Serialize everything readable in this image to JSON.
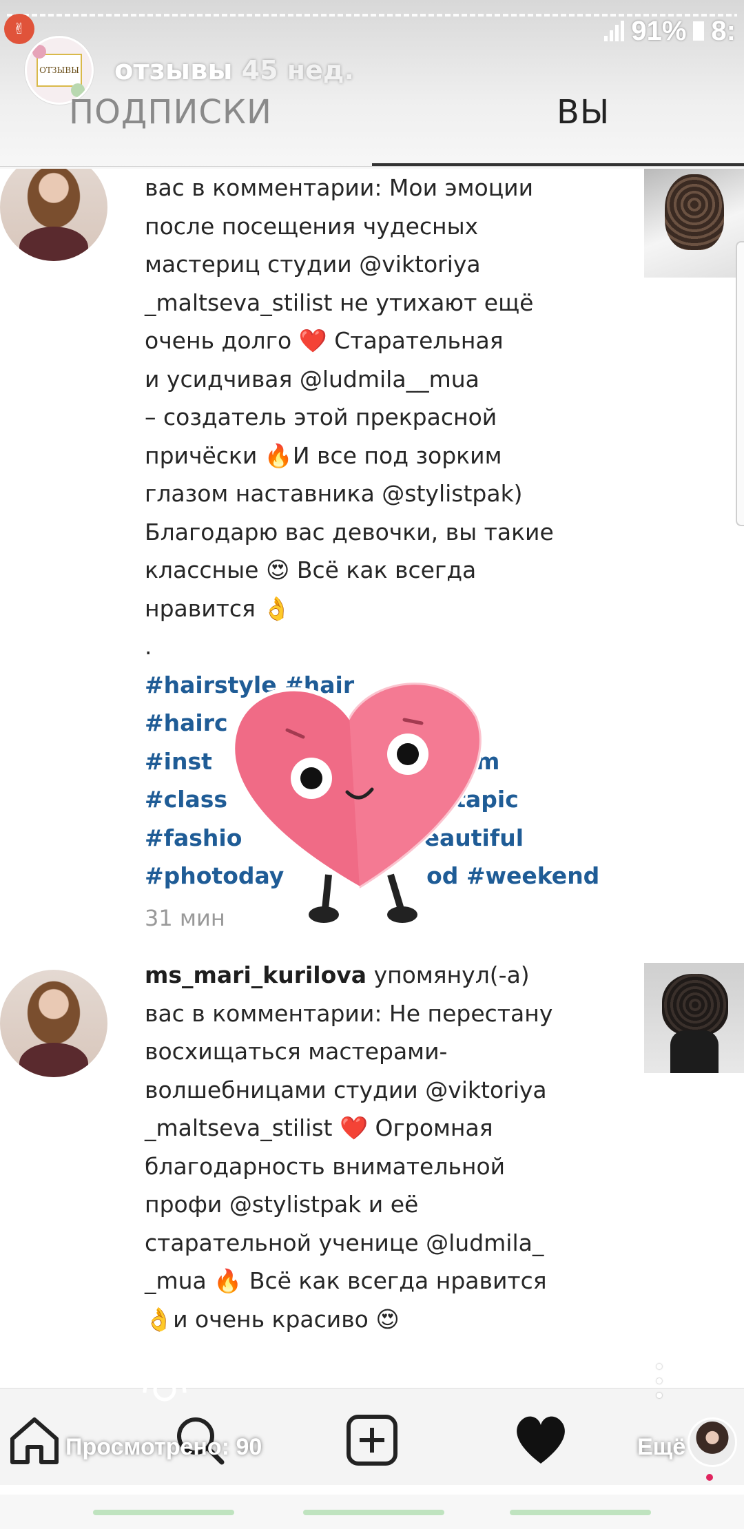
{
  "status_bar": {
    "battery": "91%",
    "time": "8:"
  },
  "story": {
    "account_name": "отзывы",
    "age": "45 нед.",
    "avatar_label": "ОТЗЫВЫ"
  },
  "tabs": [
    {
      "label": "ПОДПИСКИ",
      "selected": false
    },
    {
      "label": "ВЫ",
      "selected": true
    }
  ],
  "notifications": [
    {
      "lines": [
        "вас в комментарии: Мои эмоции",
        "после посещения чудесных",
        "мастериц студии @viktoriya",
        "_maltseva_stilist не утихают ещё",
        "очень долго ❤️ Старательная",
        "и усидчивая @ludmila__mua",
        "– создатель этой прекрасной",
        "причёски 🔥И все под зорким",
        "глазом наставника @stylistpak)",
        "Благодарю вас девочки, вы такие",
        "классные 😍 Всё как всегда",
        "нравится 👌",
        "."
      ],
      "hashtags": [
        "#hairstyle #hair",
        "#hairc                        rdo",
        "#inst                         #beam",
        "#class                        instapic",
        "#fashio                       eautiful",
        "#photoday                  od #weekend"
      ],
      "time": "31 мин"
    },
    {
      "username": "ms_mari_kurilova",
      "lines": [
        "упомянул(-а)",
        "вас в комментарии: Не перестану",
        "восхищаться мастерами-",
        "волшебницами студии @viktoriya",
        "_maltseva_stilist ❤️ Огромная",
        "благодарность внимательной",
        "профи @stylistpak и её",
        "старательной ученице @ludmila_",
        "_mua 🔥 Всё как всегда нравится",
        "👌и очень красиво 😍"
      ]
    }
  ],
  "story_footer": {
    "viewed_label": "Просмотрено: 90",
    "more_label": "Ещё"
  },
  "colors": {
    "mention": "#2a6aa3",
    "hashtag": "#1f5c96",
    "heart_sticker": "#f06b86"
  },
  "icons": [
    "home-icon",
    "search-icon",
    "add-post-icon",
    "heart-icon",
    "profile-avatar"
  ]
}
